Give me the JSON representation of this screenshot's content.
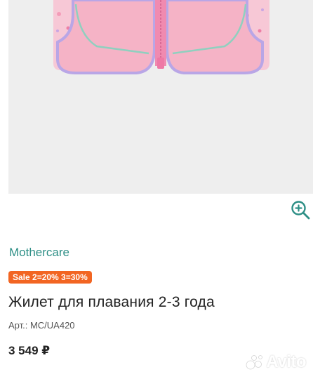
{
  "gallery": {
    "image_icon": "kids-swim-vest-photo",
    "dots_count": 5,
    "active_dot": 0,
    "zoom_icon": "zoom-in-icon"
  },
  "product": {
    "brand": "Mothercare",
    "sale_badge": "Sale 2=20% 3=30%",
    "title": "Жилет для плавания 2-3 года",
    "article": "Арт.: MC/UA420",
    "price": "3 549 ₽"
  },
  "watermark": {
    "text": "Avito"
  },
  "colors": {
    "accent": "#f26522",
    "brand": "#2e8f86",
    "dot_inactive": "#e6dccf"
  }
}
